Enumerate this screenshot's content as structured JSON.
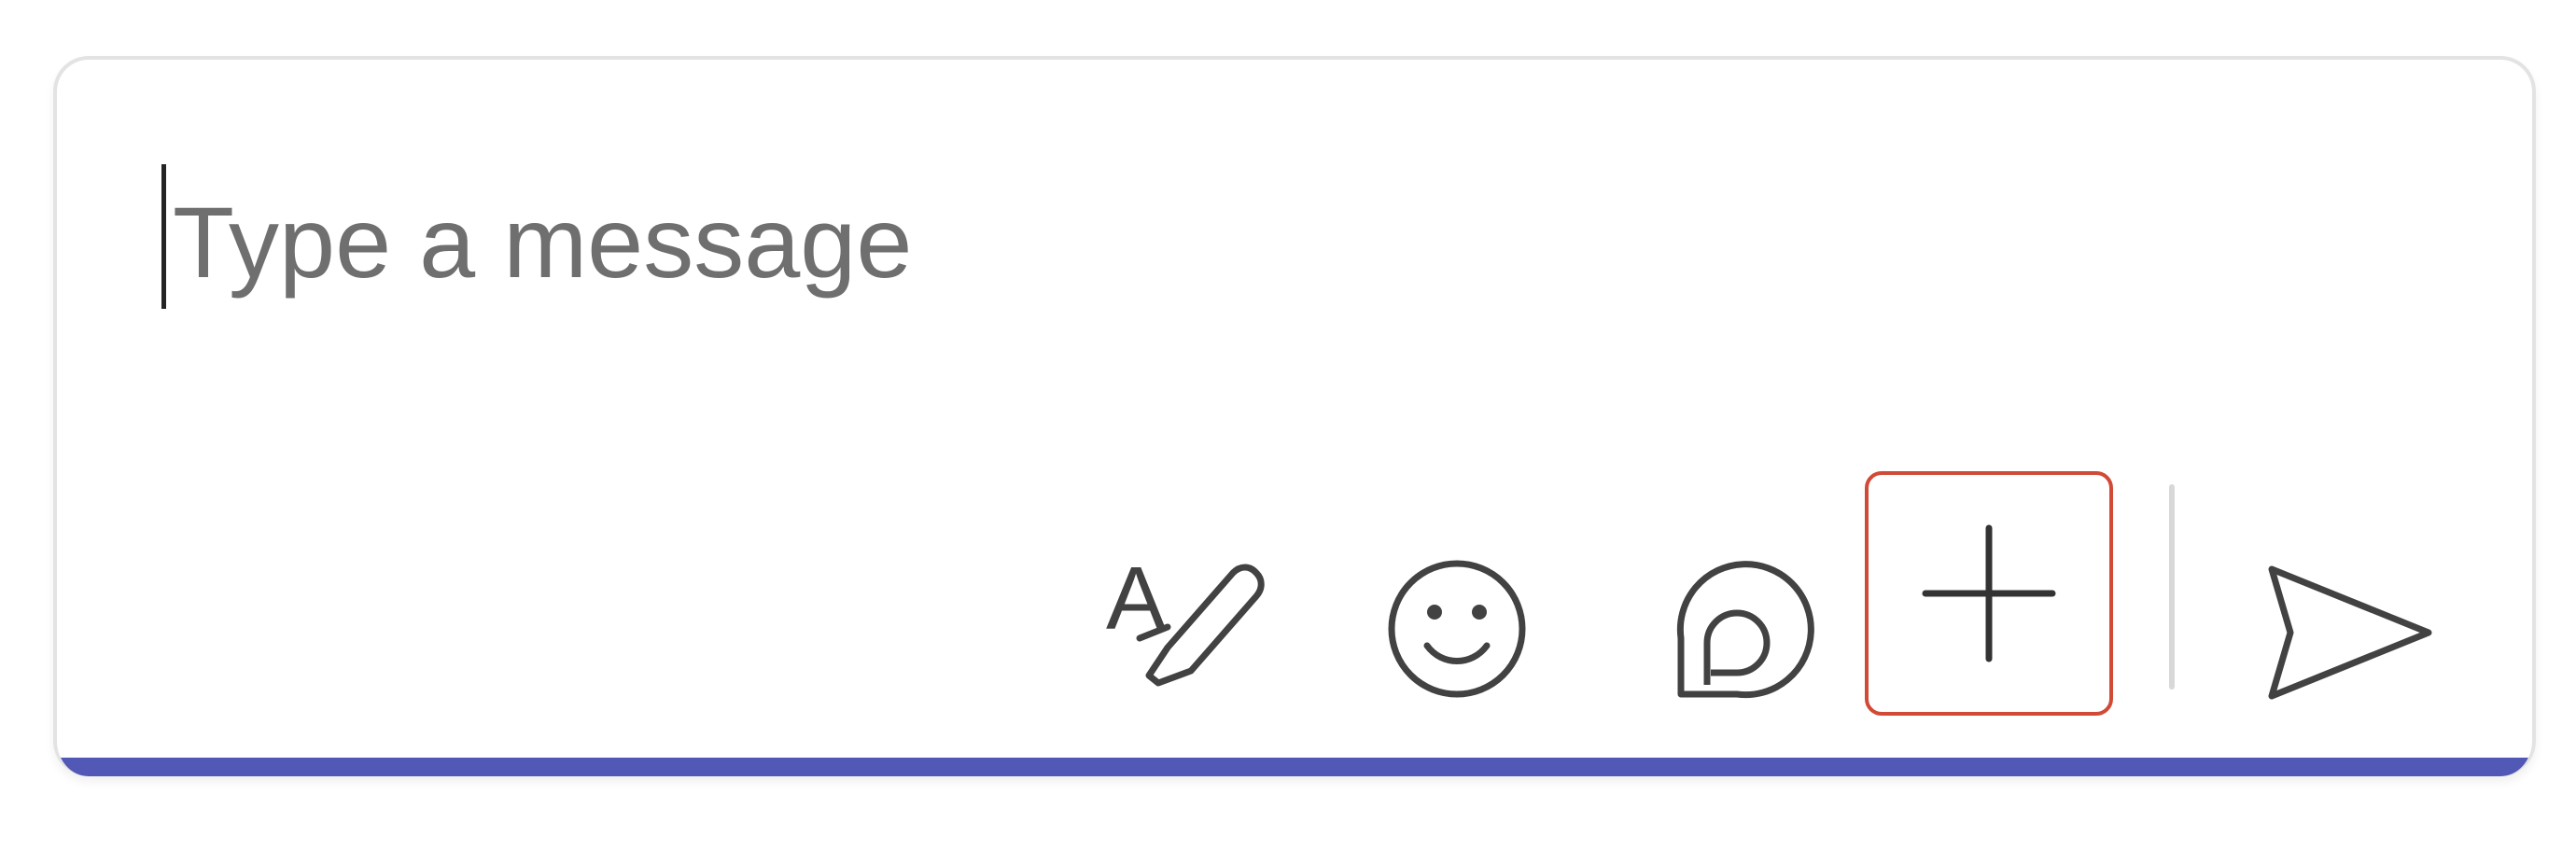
{
  "composer": {
    "placeholder": "Type a message",
    "value": "",
    "accent_color": "#5158b5"
  },
  "toolbar": {
    "buttons": [
      {
        "id": "format",
        "icon": "format-pen-icon"
      },
      {
        "id": "emoji",
        "icon": "emoji-smile-icon"
      },
      {
        "id": "loop",
        "icon": "loop-component-icon"
      },
      {
        "id": "add",
        "icon": "plus-icon",
        "highlighted": true,
        "highlight_color": "#d14a36"
      },
      {
        "id": "send",
        "icon": "send-arrow-icon"
      }
    ]
  }
}
